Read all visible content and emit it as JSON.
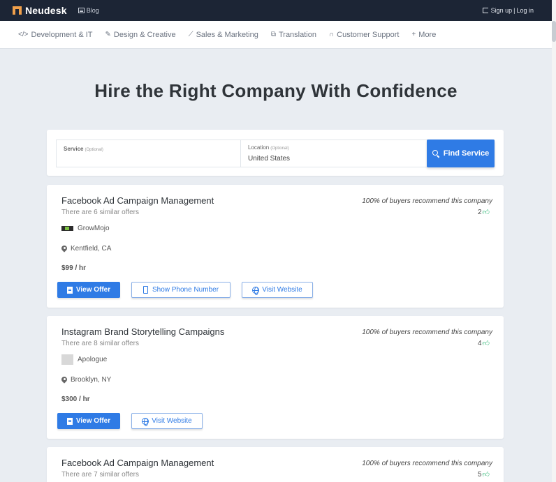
{
  "header": {
    "brand": "Neudesk",
    "blog": "Blog",
    "sign_up": "Sign up",
    "separator": "|",
    "log_in": "Log in"
  },
  "categories": [
    {
      "label": "Development & IT",
      "icon": "code-icon"
    },
    {
      "label": "Design & Creative",
      "icon": "brush-icon"
    },
    {
      "label": "Sales & Marketing",
      "icon": "chart-icon"
    },
    {
      "label": "Translation",
      "icon": "translate-icon"
    },
    {
      "label": "Customer Support",
      "icon": "headset-icon"
    },
    {
      "label": "More",
      "icon": "plus-icon"
    }
  ],
  "hero": {
    "title": "Hire the Right Company With Confidence"
  },
  "search": {
    "service_label": "Service",
    "service_optional": "(Optional)",
    "service_value": "",
    "location_label": "Location",
    "location_optional": "(Optional)",
    "location_value": "United States",
    "button_label": "Find Service"
  },
  "offers": [
    {
      "title": "Facebook Ad Campaign Management",
      "similar": "There are 6 similar offers",
      "recommend": "100% of buyers recommend this company",
      "likes": "2",
      "company": "GrowMojo",
      "location": "Kentfield, CA",
      "price": "$99 / hr",
      "view_offer": "View Offer",
      "show_phone": "Show Phone Number",
      "visit_website": "Visit Website"
    },
    {
      "title": "Instagram Brand Storytelling Campaigns",
      "similar": "There are 8 similar offers",
      "recommend": "100% of buyers recommend this company",
      "likes": "4",
      "company": "Apologue",
      "location": "Brooklyn, NY",
      "price": "$300 / hr",
      "view_offer": "View Offer",
      "visit_website": "Visit Website"
    },
    {
      "title": "Facebook Ad Campaign Management",
      "similar": "There are 7 similar offers",
      "recommend": "100% of buyers recommend this company",
      "likes": "5"
    }
  ],
  "colors": {
    "topbar": "#1c2535",
    "accent": "#2f7be5",
    "brand_logo": "#f0a04b",
    "thumb": "#2bb673",
    "page_bg": "#e9edf2"
  }
}
